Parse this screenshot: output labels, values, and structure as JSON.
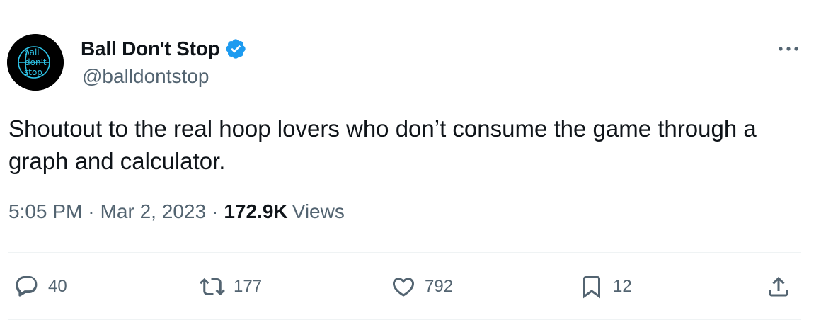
{
  "user": {
    "display_name": "Ball Don't Stop",
    "handle": "@balldontstop",
    "verified": true,
    "avatar_text": [
      "ball",
      "don't",
      "stop"
    ]
  },
  "tweet": {
    "text": "Shoutout to the real hoop lovers who don’t consume the game through a graph and calculator.",
    "time": "5:05 PM",
    "date": "Mar 2, 2023",
    "separator": "·",
    "views_count": "172.9K",
    "views_label": "Views"
  },
  "actions": {
    "reply_count": "40",
    "retweet_count": "177",
    "like_count": "792",
    "bookmark_count": "12"
  },
  "colors": {
    "text_primary": "#0f1419",
    "text_secondary": "#536471",
    "verified_blue": "#1d9bf0",
    "divider": "#eff3f4",
    "avatar_bg": "#000000",
    "avatar_accent": "#2ec4e8"
  },
  "icons": [
    "verified-badge-icon",
    "more-icon",
    "reply-icon",
    "retweet-icon",
    "like-icon",
    "bookmark-icon",
    "share-icon"
  ]
}
